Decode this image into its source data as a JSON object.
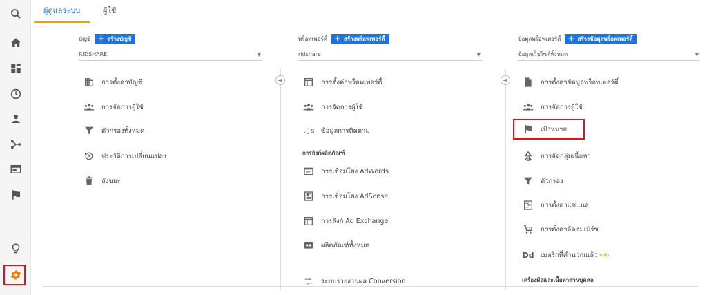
{
  "tabs": [
    {
      "label": "ผู้ดูแลระบบ",
      "active": true
    },
    {
      "label": "ผู้ใช้",
      "active": false
    }
  ],
  "rail": {
    "icons": [
      "search-icon",
      "home-icon",
      "dashboard-icon",
      "clock-icon",
      "person-icon",
      "acquisition-icon",
      "behavior-icon",
      "flag-icon",
      "lightbulb-icon",
      "gear-icon"
    ],
    "accent": "#f57c00",
    "highlight": "#e1131a"
  },
  "account": {
    "label": "บัญชี",
    "create": "สร้างบัญชี",
    "selected": "RIDSHARE",
    "items": [
      {
        "icon": "building-icon",
        "label": "การตั้งค่าบัญชี"
      },
      {
        "icon": "people-icon",
        "label": "การจัดการผู้ใช้"
      },
      {
        "icon": "filter-icon",
        "label": "ตัวกรองทั้งหมด"
      },
      {
        "icon": "history-icon",
        "label": "ประวัติการเปลี่ยนแปลง"
      },
      {
        "icon": "trash-icon",
        "label": "ถังขยะ"
      }
    ]
  },
  "property": {
    "label": "พร็อพเพอร์ตี้",
    "create": "สร้างพร็อพเพอร์ตี้",
    "selected": "ridshare",
    "items": [
      {
        "icon": "window-icon",
        "label": "การตั้งค่าพร็อพเพอร์ตี้"
      },
      {
        "icon": "people-icon",
        "label": "การจัดการผู้ใช้"
      },
      {
        "icon": "js-icon",
        "label": "ข้อมูลการติดตาม"
      }
    ],
    "section": "การลิงก์ผลิตภัณฑ์",
    "links": [
      {
        "icon": "adwords-icon",
        "label": "การเชื่อมโยง AdWords"
      },
      {
        "icon": "adsense-icon",
        "label": "การเชื่อมโยง AdSense"
      },
      {
        "icon": "exchange-icon",
        "label": "การลิงก์ Ad Exchange"
      },
      {
        "icon": "products-icon",
        "label": "ผลิตภัณฑ์ทั้งหมด"
      }
    ],
    "conversion": {
      "icon": "conversion-icon",
      "label": "ระบบรายงานผล Conversion"
    }
  },
  "view": {
    "label": "ข้อมูลพร็อพเพอร์ตี้",
    "create": "สร้างข้อมูลพร็อพเพอร์ตี้",
    "selected": "ข้อมูลเว็บไซต์ทั้งหมด",
    "items": [
      {
        "icon": "document-icon",
        "label": "การตั้งค่าข้อมูลพร็อพเพอร์ตี้"
      },
      {
        "icon": "people-icon",
        "label": "การจัดการผู้ใช้"
      },
      {
        "icon": "flag-icon",
        "label": "เป้าหมาย"
      },
      {
        "icon": "grouping-icon",
        "label": "การจัดกลุ่มเนื้อหา"
      },
      {
        "icon": "filter-icon",
        "label": "ตัวกรอง"
      },
      {
        "icon": "channel-icon",
        "label": "การตั้งค่าแชแนล"
      },
      {
        "icon": "cart-icon",
        "label": "การตั้งค่าอีคอมเมิร์ซ"
      },
      {
        "icon": "dd-icon",
        "label": "เมตริกที่คำนวณแล้ว",
        "badge": "เบต้า"
      }
    ],
    "section": "เครื่องมือและเนื้อหาส่วนบุคคล",
    "dd_text": "Dd"
  },
  "colors": {
    "primary": "#1a73e8",
    "tab_underline": "#f0a000"
  }
}
